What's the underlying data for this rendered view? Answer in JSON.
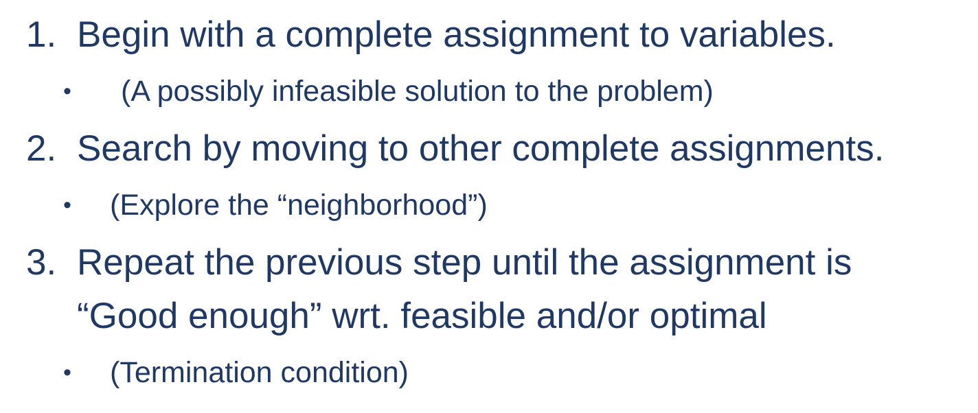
{
  "items": [
    {
      "number": "1.",
      "text": "Begin with a complete assignment to variables.",
      "sub": "(A possibly infeasible solution to the problem)"
    },
    {
      "number": "2.",
      "text": "Search by moving to other complete assignments.",
      "sub": "(Explore the “neighborhood”)"
    },
    {
      "number": "3.",
      "text": "Repeat the previous step until the assignment is",
      "text_line2": "“Good enough” wrt. feasible and/or optimal",
      "sub": "(Termination condition)"
    }
  ],
  "bullet_glyph": "•",
  "text_color": "#1f3864"
}
